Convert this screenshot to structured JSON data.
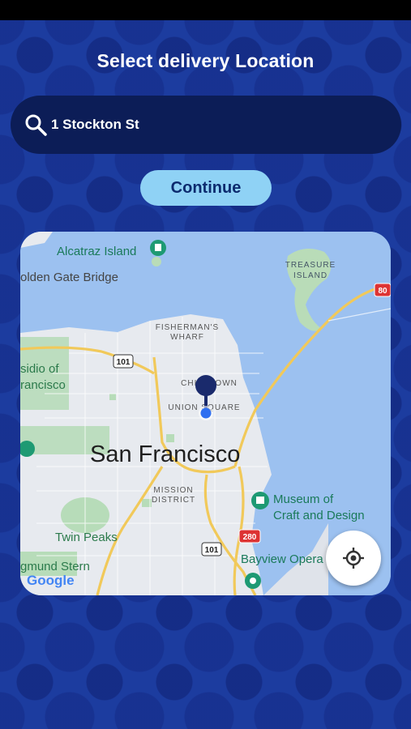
{
  "header": {
    "title": "Select delivery Location"
  },
  "search": {
    "value": "1 Stockton St",
    "icon": "search-icon"
  },
  "actions": {
    "continue_label": "Continue"
  },
  "map": {
    "labels": {
      "alcatraz": "Alcatraz Island",
      "golden_gate": "olden Gate Bridge",
      "treasure_1": "TREASURE",
      "treasure_2": "ISLAND",
      "fishermans_1": "FISHERMAN'S",
      "fishermans_2": "WHARF",
      "presidio_1": "sidio of",
      "presidio_2": "rancisco",
      "chinatown": "CHINATOWN",
      "union_square": "UNION SQUARE",
      "city": "San Francisco",
      "mission_1": "MISSION",
      "mission_2": "DISTRICT",
      "museum_1": "Museum of",
      "museum_2": "Craft and Design",
      "twin_peaks": "Twin Peaks",
      "stern": "gmund Stern",
      "bayview": "Bayview Opera",
      "logo": "Google",
      "hwy_101_a": "101",
      "hwy_101_b": "101",
      "hwy_280": "280",
      "hwy_80": "80"
    },
    "locate_icon": "crosshair-icon"
  },
  "colors": {
    "background": "#1c3c9f",
    "search_bg": "#0c1d57",
    "button_bg": "#8fd2f5",
    "water": "#9cc1f0",
    "land": "#e8eaee",
    "pin": "#1a2a6c"
  }
}
